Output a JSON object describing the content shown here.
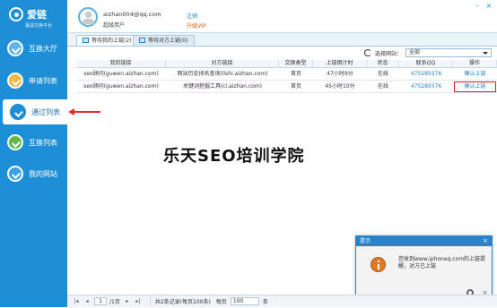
{
  "brand": {
    "name": "爱链",
    "slogan": "瀛溪交换平台"
  },
  "colors": {
    "sidebar": "#1e8fd6",
    "accent": "#1e7fd0",
    "annotation": "#e03030",
    "vip": "#e06010"
  },
  "sidebar": {
    "items": [
      {
        "label": "互换大厅",
        "icon": "exchange-icon"
      },
      {
        "label": "申请列表",
        "icon": "apply-icon"
      },
      {
        "label": "通过列表",
        "icon": "passed-icon",
        "active": true
      },
      {
        "label": "互换列表",
        "icon": "list-icon"
      },
      {
        "label": "我的网站",
        "icon": "site-icon"
      }
    ]
  },
  "user": {
    "email": "aizhan004@qq.com",
    "level": "超级用户",
    "logout": "注销",
    "upgrade": "升级VIP"
  },
  "window": {
    "minimize": "–",
    "close": "×"
  },
  "tabs": [
    {
      "label": "等待我的上链(2)",
      "active": true
    },
    {
      "label": "等待对方上链(0)",
      "active": false
    }
  ],
  "filter": {
    "label": "选择网站：",
    "value": "全部"
  },
  "table": {
    "columns": [
      "我的链接",
      "对方链接",
      "交换类型",
      "上链倒计时",
      "状态",
      "联系QQ",
      "操作"
    ],
    "rows": [
      {
        "my_link": "seo顾问(guwen.aizhan.com)",
        "other_link": "网站历史排名查询(lishi.aizhan.com)",
        "type": "首页",
        "countdown": "47小时9分",
        "status": "在线",
        "qq": "475285576",
        "action": "确认上链"
      },
      {
        "my_link": "seo顾问(guwen.aizhan.com)",
        "other_link": "关键词挖掘工具(ci.aizhan.com)",
        "type": "首页",
        "countdown": "45小时10分",
        "status": "在线",
        "qq": "475285576",
        "action": "确认上链"
      }
    ]
  },
  "watermark": "乐天SEO培训学院",
  "popup": {
    "title": "提示",
    "close": "×",
    "message": "您收到www.iphoneq.com的上链提醒，对方已上链"
  },
  "pager": {
    "page": "1",
    "total_pages": "/1页",
    "summary": "共2条记录(每页100条)",
    "per_page_label": "每页",
    "per_page": "100",
    "unit": "条"
  }
}
